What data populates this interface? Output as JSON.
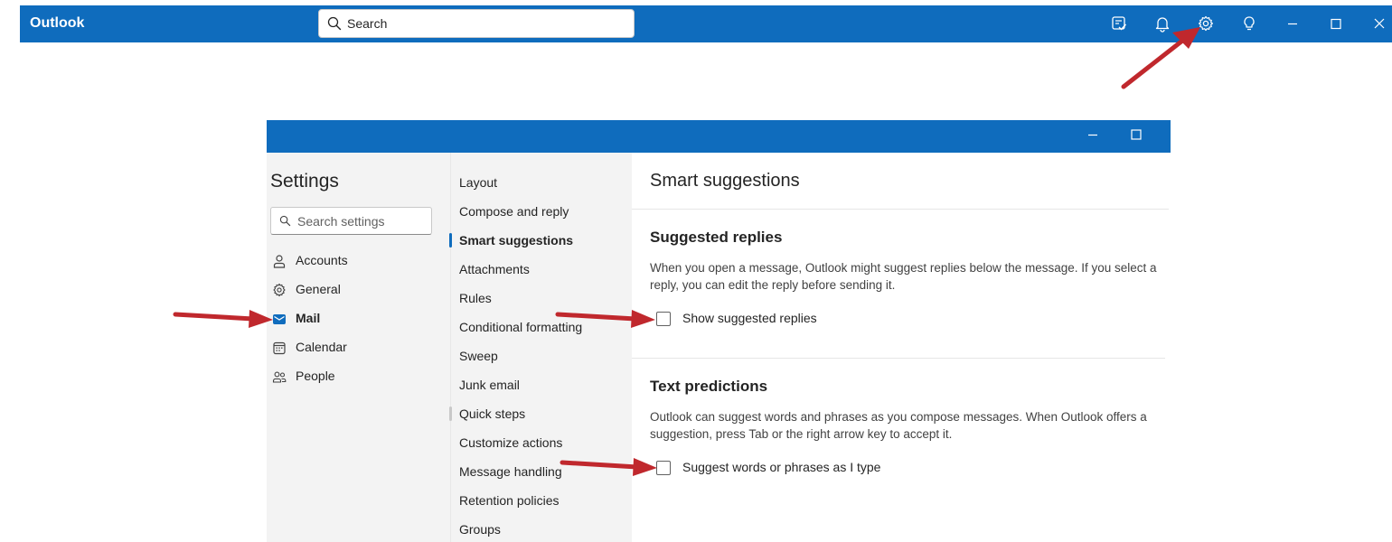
{
  "app": {
    "title": "Outlook",
    "search_label": "Search"
  },
  "toolbar_icons": [
    "my-day-icon",
    "bell-icon",
    "gear-icon",
    "lightbulb-icon",
    "minimize-icon",
    "maximize-icon",
    "close-icon"
  ],
  "settings_window": {
    "heading": "Settings",
    "search_placeholder": "Search settings",
    "nav": [
      {
        "label": "Accounts",
        "icon": "person-icon",
        "active": false
      },
      {
        "label": "General",
        "icon": "gear-icon",
        "active": false
      },
      {
        "label": "Mail",
        "icon": "mail-icon",
        "active": true
      },
      {
        "label": "Calendar",
        "icon": "calendar-icon",
        "active": false
      },
      {
        "label": "People",
        "icon": "people-icon",
        "active": false
      }
    ],
    "mail_sub": [
      {
        "label": "Layout"
      },
      {
        "label": "Compose and reply"
      },
      {
        "label": "Smart suggestions",
        "active": true
      },
      {
        "label": "Attachments"
      },
      {
        "label": "Rules"
      },
      {
        "label": "Conditional formatting"
      },
      {
        "label": "Sweep"
      },
      {
        "label": "Junk email"
      },
      {
        "label": "Quick steps"
      },
      {
        "label": "Customize actions"
      },
      {
        "label": "Message handling"
      },
      {
        "label": "Retention policies"
      },
      {
        "label": "Groups"
      }
    ],
    "content": {
      "page_title": "Smart suggestions",
      "sections": [
        {
          "title": "Suggested replies",
          "description": "When you open a message, Outlook might suggest replies below the message. If you select a reply, you can edit the reply before sending it.",
          "checkbox_label": "Show suggested replies",
          "checked": false
        },
        {
          "title": "Text predictions",
          "description": "Outlook can suggest words and phrases as you compose messages. When Outlook offers a suggestion, press Tab or the right arrow key to accept it.",
          "checkbox_label": "Suggest words or phrases as I type",
          "checked": false
        }
      ]
    }
  },
  "colors": {
    "brand": "#0f6cbd",
    "annotation_arrow": "#c0282d",
    "nav_background": "#f3f3f3"
  }
}
